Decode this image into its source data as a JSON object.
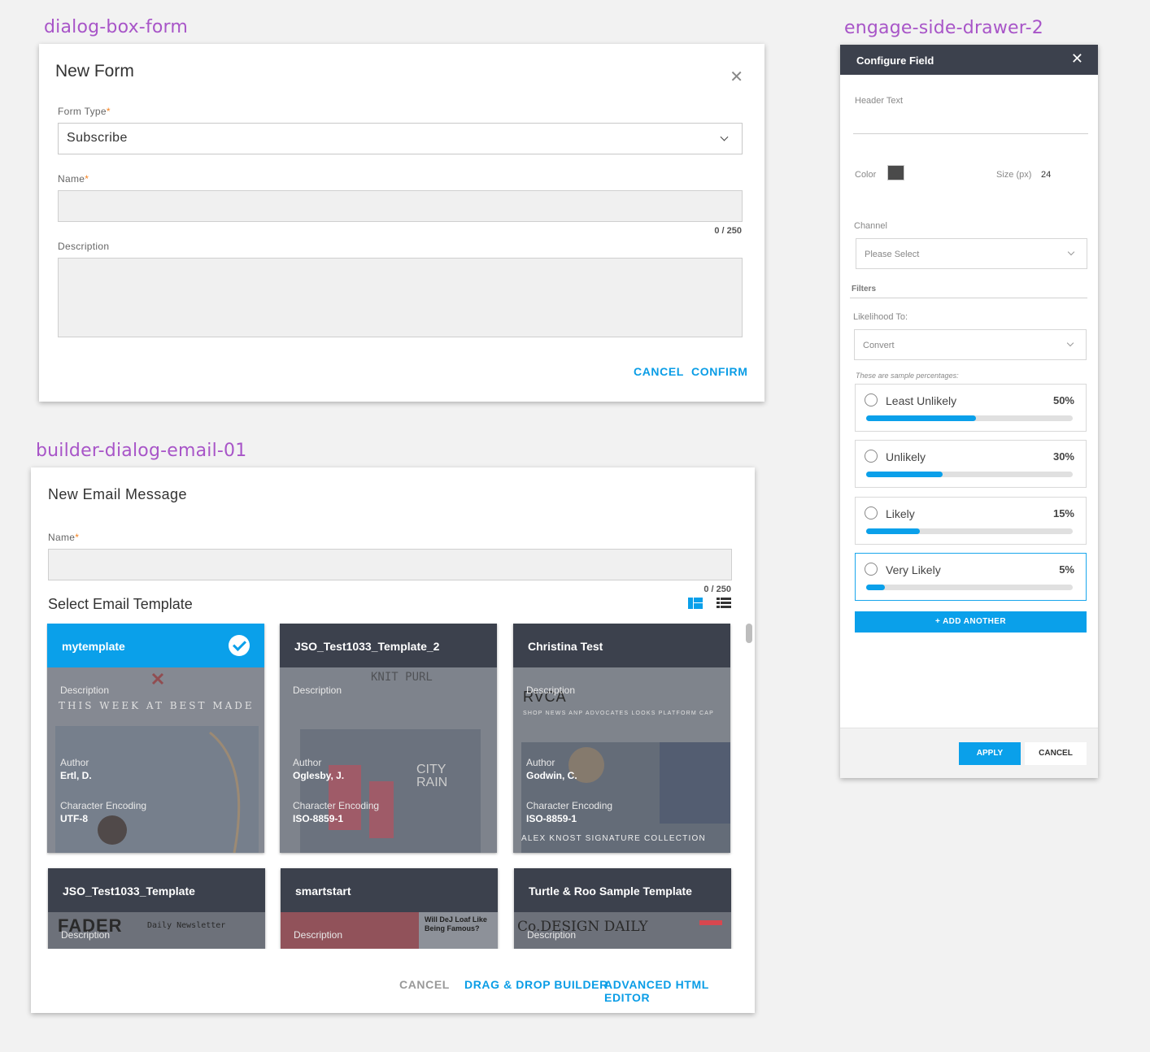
{
  "artboards": {
    "form": "dialog-box-form",
    "email": "builder-dialog-email-01",
    "drawer": "engage-side-drawer-2"
  },
  "form_dialog": {
    "title": "New Form",
    "form_type_label": "Form Type",
    "form_type_value": "Subscribe",
    "name_label": "Name",
    "name_counter": "0 / 250",
    "description_label": "Description",
    "cancel": "CANCEL",
    "confirm": "CONFIRM",
    "required_mark": "*"
  },
  "email_dialog": {
    "title": "New Email Message",
    "name_label": "Name",
    "name_counter": "0 / 250",
    "section_title": "Select Email Template",
    "meta_labels": {
      "description": "Description",
      "author": "Author",
      "encoding": "Character Encoding"
    },
    "templates": [
      {
        "name": "mytemplate",
        "author": "Ertl, D.",
        "encoding": "UTF-8",
        "selected": true
      },
      {
        "name": "JSO_Test1033_Template_2",
        "author": "Oglesby, J.",
        "encoding": "ISO-8859-1",
        "selected": false
      },
      {
        "name": "Christina Test",
        "author": "Godwin, C.",
        "encoding": "ISO-8859-1",
        "selected": false
      },
      {
        "name": "JSO_Test1033_Template",
        "selected": false
      },
      {
        "name": "smartstart",
        "selected": false
      },
      {
        "name": "Turtle & Roo Sample Template",
        "selected": false
      }
    ],
    "preview_text": {
      "best_made": "THIS WEEK AT BEST MADE",
      "knit_purl": "KNIT PURL",
      "city_rain": "CITY RAIN",
      "rvca": "RVCA",
      "rvca_nav": "SHOP NEWS ANP ADVOCATES LOOKS PLATFORM CAP",
      "alex_knost": "ALEX KNOST SIGNATURE COLLECTION",
      "fader": "FADER",
      "daily_newsletter": "Daily Newsletter",
      "dej_loaf": "Will DeJ Loaf Like Being Famous?",
      "co_design": "Co.DESIGN DAILY"
    },
    "cancel": "CANCEL",
    "drag_drop": "DRAG & DROP BUILDER",
    "html_editor": "ADVANCED HTML EDITOR",
    "colors": {
      "accent": "#0aa0ea",
      "card_head": "#3c414d"
    }
  },
  "drawer": {
    "title": "Configure Field",
    "header_text_label": "Header Text",
    "color_label": "Color",
    "color_value": "#4a4a4a",
    "size_label": "Size (px)",
    "size_value": "24",
    "channel_label": "Channel",
    "channel_placeholder": "Please Select",
    "filters_label": "Filters",
    "likelihood_label": "Likelihood To:",
    "likelihood_value": "Convert",
    "sample_note": "These are sample percentages:",
    "options": [
      {
        "label": "Least Unlikely",
        "pct_text": "50%",
        "pct": 0.53,
        "active": false
      },
      {
        "label": "Unlikely",
        "pct_text": "30%",
        "pct": 0.37,
        "active": false
      },
      {
        "label": "Likely",
        "pct_text": "15%",
        "pct": 0.26,
        "active": false
      },
      {
        "label": "Very Likely",
        "pct_text": "5%",
        "pct": 0.09,
        "active": true
      }
    ],
    "add_another": "+ ADD ANOTHER",
    "apply": "APPLY",
    "cancel": "CANCEL"
  }
}
